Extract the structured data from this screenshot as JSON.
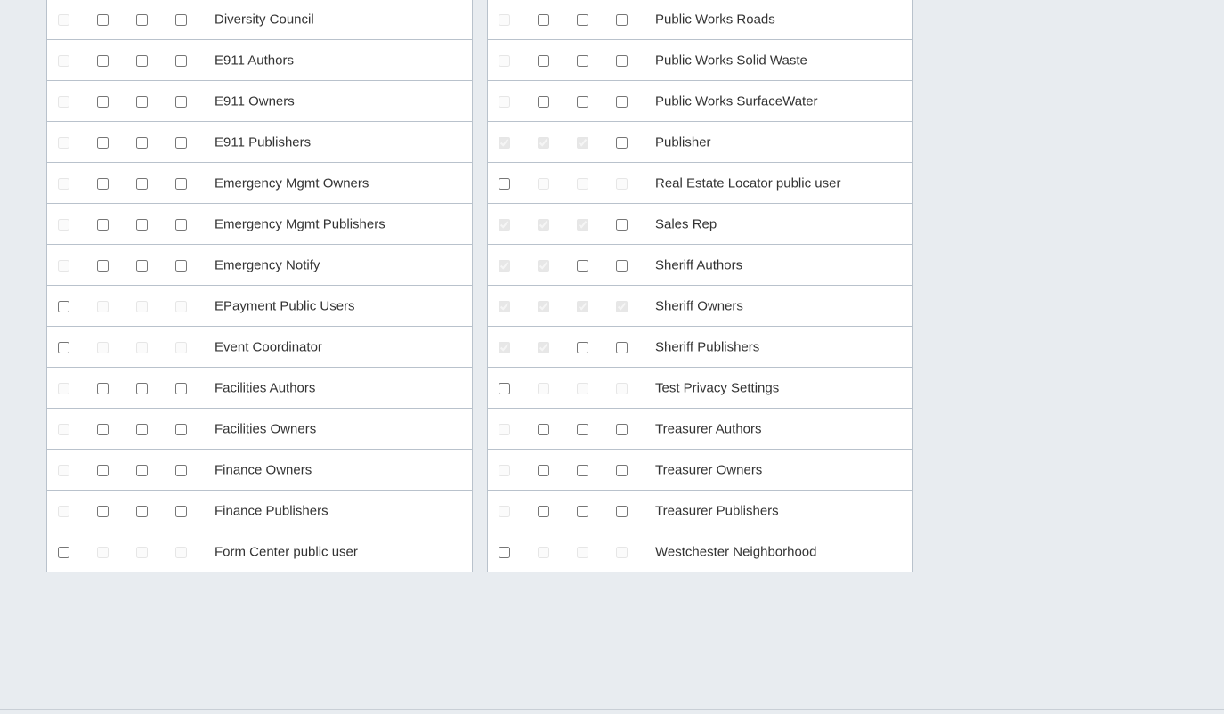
{
  "groups": {
    "left": [
      {
        "label": "Diversity Council",
        "checks": [
          [
            "false",
            "true"
          ],
          [
            "false",
            "false"
          ],
          [
            "false",
            "false"
          ],
          [
            "false",
            "false"
          ]
        ]
      },
      {
        "label": "E911 Authors",
        "checks": [
          [
            "false",
            "true"
          ],
          [
            "false",
            "false"
          ],
          [
            "false",
            "false"
          ],
          [
            "false",
            "false"
          ]
        ]
      },
      {
        "label": "E911 Owners",
        "checks": [
          [
            "false",
            "true"
          ],
          [
            "false",
            "false"
          ],
          [
            "false",
            "false"
          ],
          [
            "false",
            "false"
          ]
        ]
      },
      {
        "label": "E911 Publishers",
        "checks": [
          [
            "false",
            "true"
          ],
          [
            "false",
            "false"
          ],
          [
            "false",
            "false"
          ],
          [
            "false",
            "false"
          ]
        ]
      },
      {
        "label": "Emergency Mgmt Owners",
        "checks": [
          [
            "false",
            "true"
          ],
          [
            "false",
            "false"
          ],
          [
            "false",
            "false"
          ],
          [
            "false",
            "false"
          ]
        ]
      },
      {
        "label": "Emergency Mgmt Publishers",
        "checks": [
          [
            "false",
            "true"
          ],
          [
            "false",
            "false"
          ],
          [
            "false",
            "false"
          ],
          [
            "false",
            "false"
          ]
        ]
      },
      {
        "label": "Emergency Notify",
        "checks": [
          [
            "false",
            "true"
          ],
          [
            "false",
            "false"
          ],
          [
            "false",
            "false"
          ],
          [
            "false",
            "false"
          ]
        ]
      },
      {
        "label": "EPayment Public Users",
        "checks": [
          [
            "false",
            "false"
          ],
          [
            "false",
            "true"
          ],
          [
            "false",
            "true"
          ],
          [
            "false",
            "true"
          ]
        ]
      },
      {
        "label": "Event Coordinator",
        "checks": [
          [
            "false",
            "false"
          ],
          [
            "false",
            "true"
          ],
          [
            "false",
            "true"
          ],
          [
            "false",
            "true"
          ]
        ]
      },
      {
        "label": "Facilities Authors",
        "checks": [
          [
            "false",
            "true"
          ],
          [
            "false",
            "false"
          ],
          [
            "false",
            "false"
          ],
          [
            "false",
            "false"
          ]
        ]
      },
      {
        "label": "Facilities Owners",
        "checks": [
          [
            "false",
            "true"
          ],
          [
            "false",
            "false"
          ],
          [
            "false",
            "false"
          ],
          [
            "false",
            "false"
          ]
        ]
      },
      {
        "label": "Finance Owners",
        "checks": [
          [
            "false",
            "true"
          ],
          [
            "false",
            "false"
          ],
          [
            "false",
            "false"
          ],
          [
            "false",
            "false"
          ]
        ]
      },
      {
        "label": "Finance Publishers",
        "checks": [
          [
            "false",
            "true"
          ],
          [
            "false",
            "false"
          ],
          [
            "false",
            "false"
          ],
          [
            "false",
            "false"
          ]
        ]
      },
      {
        "label": "Form Center public user",
        "checks": [
          [
            "false",
            "false"
          ],
          [
            "false",
            "true"
          ],
          [
            "false",
            "true"
          ],
          [
            "false",
            "true"
          ]
        ]
      }
    ],
    "right": [
      {
        "label": "Public Works Roads",
        "checks": [
          [
            "false",
            "true"
          ],
          [
            "false",
            "false"
          ],
          [
            "false",
            "false"
          ],
          [
            "false",
            "false"
          ]
        ]
      },
      {
        "label": "Public Works Solid Waste",
        "checks": [
          [
            "false",
            "true"
          ],
          [
            "false",
            "false"
          ],
          [
            "false",
            "false"
          ],
          [
            "false",
            "false"
          ]
        ]
      },
      {
        "label": "Public Works SurfaceWater",
        "checks": [
          [
            "false",
            "true"
          ],
          [
            "false",
            "false"
          ],
          [
            "false",
            "false"
          ],
          [
            "false",
            "false"
          ]
        ]
      },
      {
        "label": "Publisher",
        "checks": [
          [
            "true",
            "true"
          ],
          [
            "true",
            "true"
          ],
          [
            "true",
            "true"
          ],
          [
            "false",
            "false"
          ]
        ]
      },
      {
        "label": "Real Estate Locator public user",
        "checks": [
          [
            "false",
            "false"
          ],
          [
            "false",
            "true"
          ],
          [
            "false",
            "true"
          ],
          [
            "false",
            "true"
          ]
        ]
      },
      {
        "label": "Sales Rep",
        "checks": [
          [
            "true",
            "true"
          ],
          [
            "true",
            "true"
          ],
          [
            "true",
            "true"
          ],
          [
            "false",
            "false"
          ]
        ]
      },
      {
        "label": "Sheriff Authors",
        "checks": [
          [
            "true",
            "true"
          ],
          [
            "true",
            "true"
          ],
          [
            "false",
            "false"
          ],
          [
            "false",
            "false"
          ]
        ]
      },
      {
        "label": "Sheriff Owners",
        "checks": [
          [
            "true",
            "true"
          ],
          [
            "true",
            "true"
          ],
          [
            "true",
            "true"
          ],
          [
            "true",
            "true"
          ]
        ]
      },
      {
        "label": "Sheriff Publishers",
        "checks": [
          [
            "true",
            "true"
          ],
          [
            "true",
            "true"
          ],
          [
            "false",
            "false"
          ],
          [
            "false",
            "false"
          ]
        ]
      },
      {
        "label": "Test Privacy Settings",
        "checks": [
          [
            "false",
            "false"
          ],
          [
            "false",
            "true"
          ],
          [
            "false",
            "true"
          ],
          [
            "false",
            "true"
          ]
        ]
      },
      {
        "label": "Treasurer Authors",
        "checks": [
          [
            "false",
            "true"
          ],
          [
            "false",
            "false"
          ],
          [
            "false",
            "false"
          ],
          [
            "false",
            "false"
          ]
        ]
      },
      {
        "label": "Treasurer Owners",
        "checks": [
          [
            "false",
            "true"
          ],
          [
            "false",
            "false"
          ],
          [
            "false",
            "false"
          ],
          [
            "false",
            "false"
          ]
        ]
      },
      {
        "label": "Treasurer Publishers",
        "checks": [
          [
            "false",
            "true"
          ],
          [
            "false",
            "false"
          ],
          [
            "false",
            "false"
          ],
          [
            "false",
            "false"
          ]
        ]
      },
      {
        "label": "Westchester Neighborhood",
        "checks": [
          [
            "false",
            "false"
          ],
          [
            "false",
            "true"
          ],
          [
            "false",
            "true"
          ],
          [
            "false",
            "true"
          ]
        ]
      }
    ]
  },
  "colors": {
    "page_background": "#e8ecf0",
    "panel_background": "#ffffff",
    "border": "#b9c2cc",
    "text": "#333333"
  }
}
